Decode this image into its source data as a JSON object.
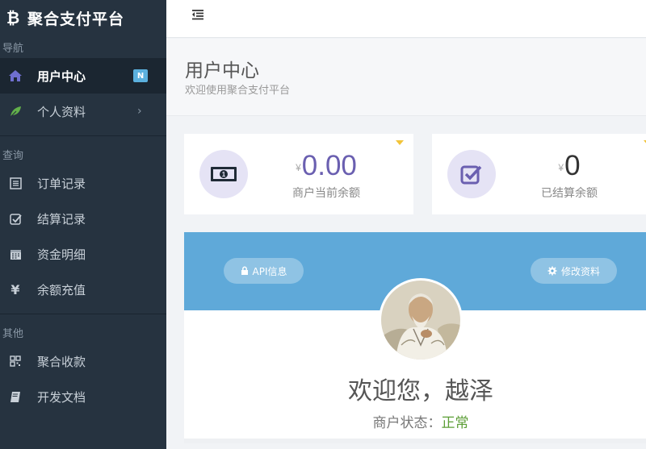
{
  "app": {
    "logo_glyph": "₿",
    "title": "聚合支付平台"
  },
  "sidebar": {
    "sections": [
      {
        "label": "导航"
      },
      {
        "label": "查询"
      },
      {
        "label": "其他"
      }
    ],
    "items": [
      {
        "label": "用户中心",
        "icon": "home-icon",
        "badge": "N",
        "active": true
      },
      {
        "label": "个人资料",
        "icon": "leaf-icon",
        "chevron": "›"
      },
      {
        "label": "订单记录",
        "icon": "list-icon"
      },
      {
        "label": "结算记录",
        "icon": "check-square-icon"
      },
      {
        "label": "资金明细",
        "icon": "calendar-icon"
      },
      {
        "label": "余额充值",
        "icon": "yen-icon"
      },
      {
        "label": "聚合收款",
        "icon": "qrcode-icon"
      },
      {
        "label": "开发文档",
        "icon": "book-icon"
      }
    ]
  },
  "header": {
    "title": "用户中心",
    "subtitle": "欢迎使用聚合支付平台"
  },
  "stats": [
    {
      "currency": "¥",
      "value": "0.00",
      "label": "商户当前余额",
      "icon": "money-icon"
    },
    {
      "currency": "¥",
      "value": "0",
      "label": "已结算余额",
      "icon": "check-square-icon"
    }
  ],
  "profile": {
    "api_button": "API信息",
    "edit_button": "修改资料",
    "welcome": "欢迎您，越泽",
    "status_label": "商户状态：",
    "status_value": "正常"
  },
  "colors": {
    "sidebar_bg": "#263340",
    "accent": "#6a5fb0",
    "banner": "#5fa9d9",
    "status_ok": "#5c9e36",
    "badge": "#5bb0de"
  }
}
